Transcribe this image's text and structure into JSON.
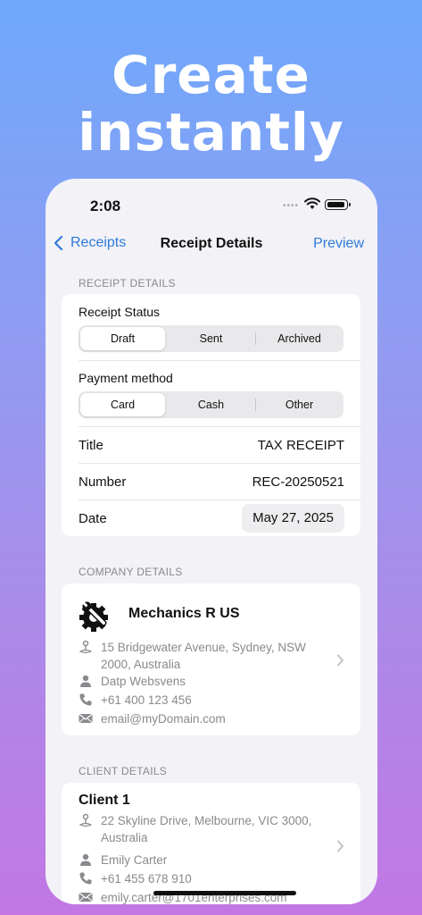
{
  "headline": {
    "line1": "Create",
    "line2": "instantly"
  },
  "status_bar": {
    "time": "2:08",
    "signal": "••••"
  },
  "nav": {
    "back_label": "Receipts",
    "title": "Receipt Details",
    "preview_label": "Preview"
  },
  "receipt_details": {
    "header": "RECEIPT DETAILS",
    "status_label": "Receipt Status",
    "status_options": [
      "Draft",
      "Sent",
      "Archived"
    ],
    "status_selected": "Draft",
    "payment_label": "Payment method",
    "payment_options": [
      "Card",
      "Cash",
      "Other"
    ],
    "payment_selected": "Card",
    "title_label": "Title",
    "title_value": "TAX RECEIPT",
    "number_label": "Number",
    "number_value": "REC-20250521",
    "date_label": "Date",
    "date_value": "May 27, 2025"
  },
  "company_details": {
    "header": "COMPANY DETAILS",
    "name": "Mechanics R US",
    "logo_icon": "gear-wrench-icon",
    "address": "15 Bridgewater Avenue, Sydney, NSW 2000, Australia",
    "contact": "Datp Websvens",
    "phone": "+61 400 123 456",
    "email": "email@myDomain.com"
  },
  "client_details": {
    "header": "CLIENT DETAILS",
    "name": "Client 1",
    "address": "22 Skyline Drive, Melbourne, VIC 3000, Australia",
    "contact": "Emily Carter",
    "phone": "+61 455 678 910",
    "email": "emily.carter@1701enterprises.com"
  },
  "colors": {
    "accent": "#2f7bd8",
    "secondary_text": "#8a8a8e",
    "background": "#f2f2f7"
  }
}
